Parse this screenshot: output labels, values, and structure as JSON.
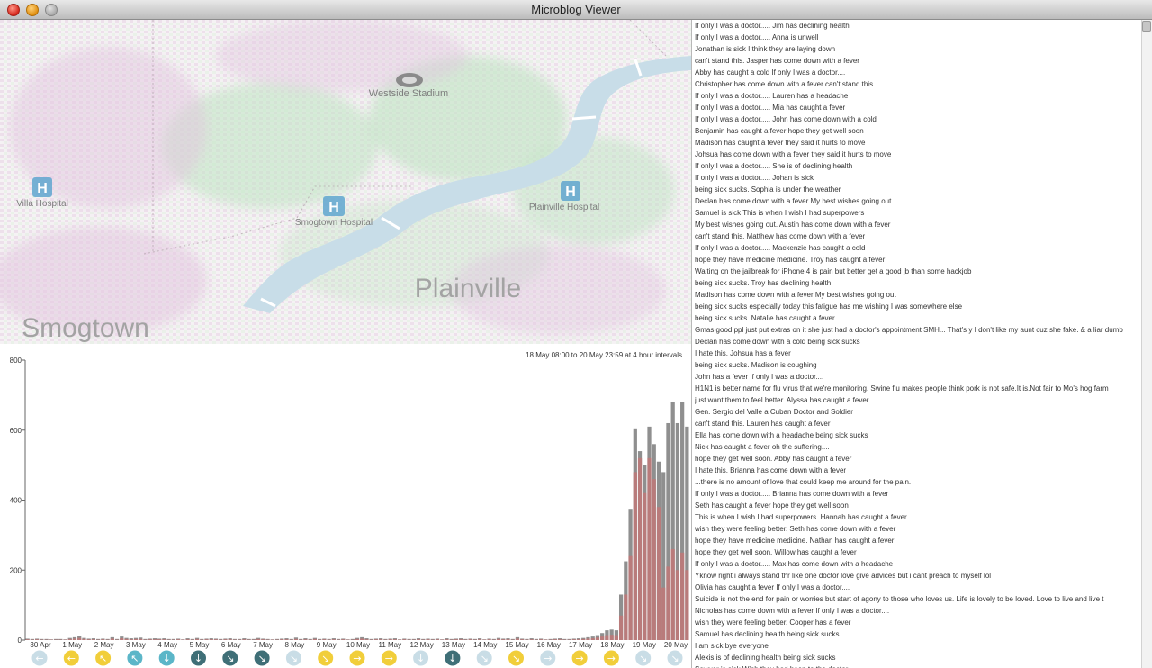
{
  "window": {
    "title": "Microblog Viewer"
  },
  "map": {
    "labels": {
      "stadium": "Westside Stadium",
      "villa_hospital": "Villa Hospital",
      "smogtown_hospital": "Smogtown Hospital",
      "plainville_hospital": "Plainville Hospital",
      "plainville": "Plainville",
      "smogtown": "Smogtown"
    },
    "colors": {
      "river": "#c8dde8",
      "hospital_icon": "#5fa6cf",
      "green_density": "#7ec98f",
      "purple_density": "#c79fc7"
    }
  },
  "chart": {
    "range_label": "18 May 08:00 to 20 May 23:59 at 4 hour intervals",
    "colors": {
      "total": "#8f8f8f",
      "sick": "#b97b7b"
    },
    "chart_data": {
      "type": "bar",
      "ylim": [
        0,
        800
      ],
      "y_ticks": [
        "0",
        "200",
        "400",
        "600",
        "800"
      ],
      "date_labels": [
        "30 Apr",
        "1 May",
        "2 May",
        "3 May",
        "4 May",
        "5 May",
        "6 May",
        "7 May",
        "8 May",
        "9 May",
        "10 May",
        "11 May",
        "12 May",
        "13 May",
        "14 May",
        "15 May",
        "16 May",
        "17 May",
        "18 May",
        "19 May",
        "20 May"
      ],
      "series": [
        {
          "values": [
            4,
            3,
            4,
            3,
            3,
            2,
            3,
            3,
            2,
            6,
            8,
            12,
            6,
            4,
            5,
            3,
            4,
            3,
            8,
            3,
            10,
            6,
            5,
            6,
            7,
            3,
            4,
            5,
            4,
            5,
            3,
            3,
            4,
            2,
            5,
            3,
            6,
            3,
            4,
            5,
            4,
            3,
            4,
            5,
            3,
            3,
            5,
            3,
            3,
            6,
            4,
            3,
            2,
            3,
            4,
            5,
            3,
            7,
            3,
            5,
            3,
            6,
            3,
            4,
            3,
            5,
            3,
            4,
            2,
            3,
            6,
            8,
            5,
            3,
            4,
            5,
            3,
            4,
            5,
            2,
            4,
            3,
            3,
            5,
            3,
            4,
            3,
            4,
            2,
            5,
            3,
            4,
            5,
            3,
            4,
            3,
            5,
            2,
            4,
            3,
            6,
            4,
            5,
            3,
            8,
            4,
            3,
            5,
            3,
            4,
            2,
            3,
            4,
            5,
            3,
            3,
            4,
            5,
            6,
            8,
            10,
            14,
            20,
            28,
            30,
            28,
            130,
            225,
            375,
            605,
            540,
            500,
            610,
            560,
            510,
            480,
            620,
            680,
            620,
            680,
            610
          ]
        },
        {
          "values": [
            2,
            1,
            2,
            1,
            1,
            1,
            1,
            1,
            1,
            3,
            4,
            6,
            3,
            2,
            2,
            1,
            2,
            1,
            4,
            1,
            5,
            3,
            2,
            3,
            3,
            1,
            2,
            2,
            2,
            2,
            1,
            1,
            2,
            1,
            2,
            1,
            3,
            1,
            2,
            2,
            2,
            1,
            2,
            2,
            1,
            1,
            2,
            1,
            1,
            3,
            2,
            1,
            1,
            1,
            2,
            2,
            1,
            3,
            1,
            2,
            1,
            3,
            1,
            2,
            1,
            2,
            1,
            2,
            1,
            1,
            3,
            4,
            2,
            1,
            2,
            2,
            1,
            2,
            2,
            1,
            2,
            1,
            1,
            2,
            1,
            2,
            1,
            2,
            1,
            2,
            1,
            2,
            2,
            1,
            2,
            1,
            2,
            1,
            2,
            1,
            3,
            2,
            2,
            1,
            4,
            2,
            1,
            2,
            1,
            2,
            1,
            1,
            2,
            2,
            1,
            1,
            2,
            2,
            3,
            4,
            5,
            7,
            10,
            14,
            15,
            14,
            70,
            130,
            240,
            480,
            520,
            420,
            520,
            460,
            380,
            150,
            210,
            260,
            200,
            250,
            200
          ]
        }
      ]
    },
    "arrow_markers": [
      {
        "dir": "←",
        "color": "#c9dde6"
      },
      {
        "dir": "←",
        "color": "#f1ce3a"
      },
      {
        "dir": "↖",
        "color": "#f1ce3a"
      },
      {
        "dir": "↖",
        "color": "#5bb6c8"
      },
      {
        "dir": "↓",
        "color": "#5bb6c8"
      },
      {
        "dir": "↓",
        "color": "#3f6f77"
      },
      {
        "dir": "↘",
        "color": "#3f6f77"
      },
      {
        "dir": "↘",
        "color": "#3f6f77"
      },
      {
        "dir": "↘",
        "color": "#c9dde6"
      },
      {
        "dir": "↘",
        "color": "#f1ce3a"
      },
      {
        "dir": "→",
        "color": "#f1ce3a"
      },
      {
        "dir": "→",
        "color": "#f1ce3a"
      },
      {
        "dir": "↓",
        "color": "#c9dde6"
      },
      {
        "dir": "↓",
        "color": "#3f6f77"
      },
      {
        "dir": "↘",
        "color": "#c9dde6"
      },
      {
        "dir": "↘",
        "color": "#f1ce3a"
      },
      {
        "dir": "→",
        "color": "#c9dde6"
      },
      {
        "dir": "→",
        "color": "#f1ce3a"
      },
      {
        "dir": "→",
        "color": "#f1ce3a"
      },
      {
        "dir": "↘",
        "color": "#c9dde6"
      },
      {
        "dir": "↘",
        "color": "#c9dde6"
      }
    ]
  },
  "feed": {
    "items": [
      "If only I was a doctor..... Jim has declining health",
      "If only I was a doctor..... Anna is unwell",
      "Jonathan is sick I think they are laying down",
      "can't stand this. Jasper has come down with a fever",
      "Abby has caught a cold If only I was a doctor....",
      "Christopher has come down with a fever can't stand this",
      "If only I was a doctor..... Lauren has a headache",
      "If only I was a doctor..... Mia has caught a fever",
      "If only I was a doctor..... John has come down with a cold",
      "Benjamin has caught a fever hope they get well soon",
      "Madison has caught a fever they said it hurts to move",
      "Johsua has come down with a fever they said it hurts to move",
      "If only I was a doctor..... She is of declining health",
      "If only I was a doctor..... Johan is sick",
      "being sick sucks. Sophia is under the weather",
      "Declan has come down with a fever My best wishes going out",
      "Samuel is sick This is when I wish I had superpowers",
      "My best wishes going out. Austin has come down with a fever",
      "can't stand this. Matthew has come down with a fever",
      "If only I was a doctor..... Mackenzie has caught a cold",
      "hope they have medicine medicine. Troy has caught a fever",
      "Waiting on the jailbreak for iPhone 4 is pain  but better get a good jb than some hackjob",
      "being sick sucks. Troy has declining health",
      "Madison has come down with a fever My best wishes going out",
      "being sick sucks especially today this fatigue has me wishing I was somewhere else",
      "being sick sucks. Natalie has caught a fever",
      "Gmas good ppl just put extras on it she just had a doctor's appointment SMH... That's y I don't like my aunt cuz she fake. & a liar dumb",
      "Declan has come down with a cold being sick sucks",
      "I hate this. Johsua has a fever",
      "being sick sucks. Madison is coughing",
      "John has a fever If only I was a doctor....",
      "H1N1 is  better name for flu virus that we're  monitoring. Swine flu makes people think pork is not safe.It is.Not fair to Mo's hog farm",
      "just want them to feel better. Alyssa has caught a fever",
      "Gen. Sergio del Valle  a Cuban Doctor and Soldier",
      "can't stand this. Lauren has caught a fever",
      "Ella has come down with a headache being sick sucks",
      "Nick has caught a fever oh the suffering....",
      "hope they get well soon. Abby has caught a fever",
      "I hate this. Brianna has come down with a fever",
      "...there is no amount of love that could keep me around for the pain.",
      "If only I was a doctor..... Brianna has come down with a fever",
      "Seth has caught a fever hope they get well soon",
      "This is when I wish I had superpowers. Hannah has caught a fever",
      "wish they were feeling better. Seth has come down with a fever",
      "hope they have medicine medicine. Nathan has caught a fever",
      "hope they get well soon. Willow has caught a fever",
      "If only I was a doctor..... Max has come down with a headache",
      "Yknow right  i always stand thr like one doctor love give advices but i cant preach to myself lol",
      "Olivia has caught a fever If only I was a doctor....",
      "Suicide is not the end for pain or worries but start of agony to those who loves us. Life is lovely to be loved. Love to live and live t",
      "Nicholas has come down with a fever If only I was a doctor....",
      "wish they were feeling better. Cooper has a fever",
      "Samuel has declining health being sick sucks",
      "I am sick bye everyone",
      "Alexis is of declining health being sick sucks",
      "Sawyer is sick Wish they had been to the doctor"
    ]
  }
}
